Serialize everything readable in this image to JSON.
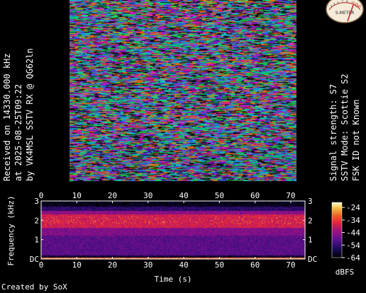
{
  "reception": {
    "line1": "Received on  14330.000 kHz",
    "line2": "at 2025-08-25T09:22",
    "line3": "by VK4MSL SSTV RX @ QG62ln"
  },
  "decode": {
    "signal": "Signal strength: S7",
    "mode": "SSTV Mode: Scottie S2",
    "fsk": "FSK ID not Known"
  },
  "meter": {
    "label": "S-METER",
    "scale": [
      "1",
      "3",
      "5",
      "7",
      "9",
      "+20",
      "+40",
      "+60"
    ],
    "value": "S7",
    "colors": {
      "face": "#f4ecd8",
      "scale": "#b52020",
      "needle": "#c0202a"
    }
  },
  "chart_data": {
    "type": "heatmap",
    "xlabel": "Time (s)",
    "ylabel": "Frequency (kHz)",
    "x_ticks": [
      "0",
      "10",
      "20",
      "30",
      "40",
      "50",
      "60",
      "70"
    ],
    "y_ticks": [
      "DC",
      "1",
      "2",
      "3"
    ],
    "xlim": [
      0,
      74
    ],
    "ylim": [
      0,
      3
    ],
    "colorbar": {
      "label": "dBFS",
      "ticks": [
        "-24",
        "-34",
        "-44",
        "-54",
        "-64"
      ],
      "range": [
        -64,
        -20
      ],
      "colors": [
        "#000000",
        "#1a0a5a",
        "#5a1090",
        "#a01080",
        "#e02040",
        "#f06020",
        "#f8c040",
        "#ffffe0"
      ]
    },
    "bands": [
      {
        "from_khz": 0.0,
        "to_khz": 0.06,
        "level_dbfs": -30
      },
      {
        "from_khz": 0.06,
        "to_khz": 0.2,
        "level_dbfs": -60
      },
      {
        "from_khz": 0.2,
        "to_khz": 1.2,
        "level_dbfs": -50
      },
      {
        "from_khz": 1.2,
        "to_khz": 1.6,
        "level_dbfs": -46
      },
      {
        "from_khz": 1.6,
        "to_khz": 2.3,
        "level_dbfs": -38
      },
      {
        "from_khz": 2.3,
        "to_khz": 2.5,
        "level_dbfs": -45
      },
      {
        "from_khz": 2.5,
        "to_khz": 2.7,
        "level_dbfs": -55
      },
      {
        "from_khz": 2.7,
        "to_khz": 3.0,
        "level_dbfs": -62
      }
    ],
    "grid": false
  },
  "footer": {
    "credit": "Created by SoX"
  }
}
